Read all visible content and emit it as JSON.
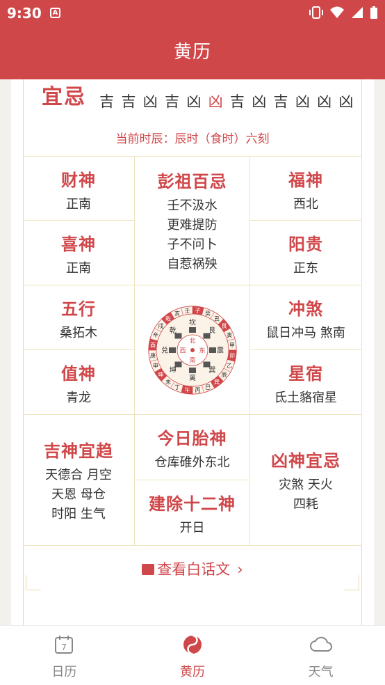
{
  "status_bar": {
    "time": "9:30",
    "notif_icon": "A"
  },
  "app_bar": {
    "title": "黄历"
  },
  "yiji": {
    "label": "宜忌",
    "hours": [
      "吉",
      "吉",
      "凶",
      "吉",
      "凶",
      "凶",
      "吉",
      "凶",
      "吉",
      "凶",
      "凶",
      "凶"
    ],
    "current_index": 5,
    "current_time": "当前时辰：辰时（食时）六刻"
  },
  "cells": {
    "caishen": {
      "title": "财神",
      "value": "正南"
    },
    "pengzu": {
      "title": "彭祖百忌",
      "lines": [
        "壬不汲水",
        "更难提防",
        "子不问卜",
        "自惹祸殃"
      ]
    },
    "fushen": {
      "title": "福神",
      "value": "西北"
    },
    "xishen": {
      "title": "喜神",
      "value": "正南"
    },
    "yanggui": {
      "title": "阳贵",
      "value": "正东"
    },
    "wuxing": {
      "title": "五行",
      "value": "桑拓木"
    },
    "chongsha": {
      "title": "冲煞",
      "value": "鼠日冲马 煞南"
    },
    "zhishen": {
      "title": "值神",
      "value": "青龙"
    },
    "xingxiu": {
      "title": "星宿",
      "value": "氐土貉宿星"
    },
    "jishen": {
      "title": "吉神宜趋",
      "lines": [
        "天德合 月空",
        "天恩 母仓",
        "时阳 生气"
      ]
    },
    "taishen": {
      "title": "今日胎神",
      "value": "仓库碓外东北"
    },
    "xiongshen": {
      "title": "凶神宜忌",
      "lines": [
        "灾煞 天火",
        "四耗"
      ]
    },
    "jianchu": {
      "title": "建除十二神",
      "value": "开日"
    }
  },
  "compass": {
    "center": "",
    "dirs": [
      "北",
      "东",
      "南",
      "西"
    ],
    "inner_ring": [
      "坎",
      "艮",
      "震",
      "巽",
      "离",
      "坤",
      "兑",
      "乾"
    ],
    "outer_ring": [
      "子",
      "癸",
      "丑",
      "艮",
      "寅",
      "甲",
      "卯",
      "乙",
      "辰",
      "巽",
      "巳",
      "丙",
      "午",
      "丁",
      "未",
      "坤",
      "申",
      "庚",
      "酉",
      "辛",
      "戌",
      "乾",
      "亥",
      "壬"
    ]
  },
  "more_link": {
    "label": "查看白话文"
  },
  "tabs": [
    {
      "label": "日历",
      "icon": "calendar-icon",
      "day": "7"
    },
    {
      "label": "黄历",
      "icon": "almanac-icon"
    },
    {
      "label": "天气",
      "icon": "cloud-icon"
    }
  ],
  "colors": {
    "primary": "#d0474a",
    "border": "#efe3bd",
    "text": "#333333"
  }
}
